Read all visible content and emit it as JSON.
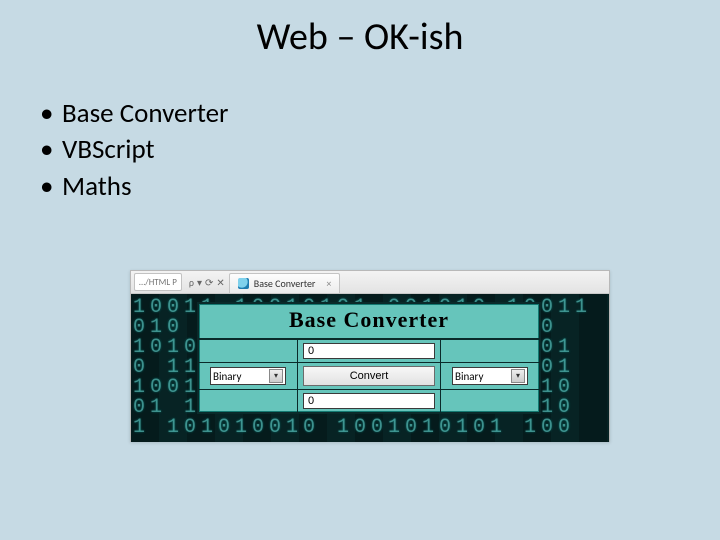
{
  "slide": {
    "title": "Web – OK-ish",
    "bullets": [
      "Base Converter",
      "VBScript",
      "Maths"
    ]
  },
  "browser": {
    "address_fragment": "…/HTML P",
    "search_hint": "ρ",
    "refresh_glyph": "⟳",
    "stop_glyph": "✕",
    "tab_title": "Base Converter",
    "tab_close": "×"
  },
  "background_digits": "10011 10010101 001010 10011\n010 1100101010100 10101 0\n1010010 10001 101010 1 101\n0 110110010100101010101 01\n1001 0100101001 1010101 10\n01 101001 1010101 1001 010\n1 101010010 1001010101 100",
  "converter": {
    "heading": "Base Converter",
    "input_value": "0",
    "output_value": "0",
    "convert_label": "Convert",
    "from_select": {
      "value": "Binary",
      "caret": "▾"
    },
    "to_select": {
      "value": "Binary",
      "caret": "▾"
    }
  }
}
